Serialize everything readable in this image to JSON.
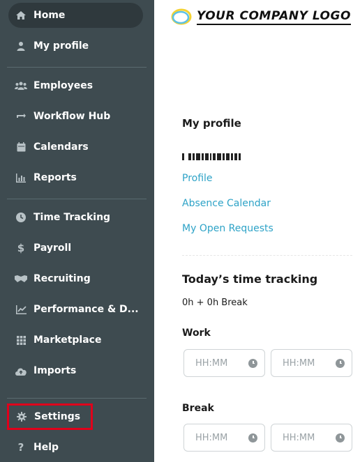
{
  "sidebar": {
    "items": [
      {
        "label": "Home",
        "icon": "home-icon"
      },
      {
        "label": "My profile",
        "icon": "user-icon"
      },
      {
        "label": "Employees",
        "icon": "people-icon"
      },
      {
        "label": "Workflow Hub",
        "icon": "workflow-icon"
      },
      {
        "label": "Calendars",
        "icon": "calendar-icon"
      },
      {
        "label": "Reports",
        "icon": "reports-icon"
      },
      {
        "label": "Time Tracking",
        "icon": "clock-icon"
      },
      {
        "label": "Payroll",
        "icon": "dollar-icon"
      },
      {
        "label": "Recruiting",
        "icon": "handshake-icon"
      },
      {
        "label": "Performance & D...",
        "icon": "chart-icon"
      },
      {
        "label": "Marketplace",
        "icon": "grid-icon"
      },
      {
        "label": "Imports",
        "icon": "cloud-upload-icon"
      },
      {
        "label": "Settings",
        "icon": "gear-icon"
      },
      {
        "label": "Help",
        "icon": "question-icon"
      }
    ],
    "active": "Home",
    "highlighted": "Settings",
    "highlight_color": "#e0001b"
  },
  "logo": {
    "text": "YOUR COMPANY LOGO"
  },
  "main": {
    "title": "My profile",
    "links": [
      "Profile",
      "Absence Calendar",
      "My Open Requests"
    ],
    "time_tracking": {
      "title": "Today’s time tracking",
      "summary": "0h + 0h Break",
      "work_label": "Work",
      "break_label": "Break",
      "placeholder": "HH:MM"
    }
  },
  "colors": {
    "sidebar_bg": "#3e4b50",
    "link": "#2ea3c7"
  }
}
